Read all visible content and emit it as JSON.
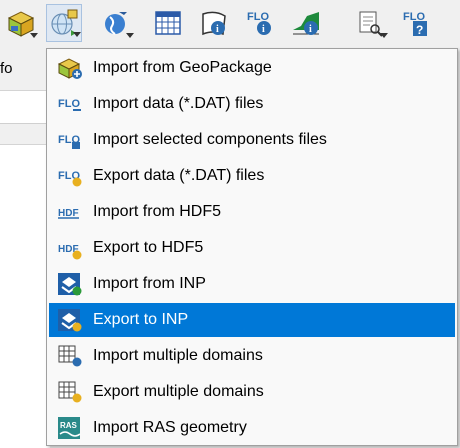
{
  "toolbar": {
    "buttons": [
      {
        "icon": "geopackage-3d-icon"
      },
      {
        "icon": "import-export-globe-icon",
        "active": true
      },
      {
        "icon": "globe-arrow-icon"
      },
      {
        "icon": "grid-table-icon"
      },
      {
        "icon": "map-info-icon"
      },
      {
        "icon": "flo-info-icon"
      },
      {
        "icon": "profile-info-icon"
      },
      {
        "icon": "report-search-icon"
      },
      {
        "icon": "flo-help-icon"
      }
    ]
  },
  "left_panel": {
    "tab_label": "fo"
  },
  "menu": {
    "items": [
      {
        "label": "Import from GeoPackage",
        "icon": "geopackage-import-icon"
      },
      {
        "label": "Import data (*.DAT) files",
        "icon": "flo-import-icon"
      },
      {
        "label": "Import selected components files",
        "icon": "flo-import-selected-icon"
      },
      {
        "label": "Export data (*.DAT) files",
        "icon": "flo-export-icon"
      },
      {
        "label": "Import from HDF5",
        "icon": "hdf5-import-icon"
      },
      {
        "label": "Export to HDF5",
        "icon": "hdf5-export-icon"
      },
      {
        "label": "Import from INP",
        "icon": "inp-import-icon"
      },
      {
        "label": "Export to INP",
        "icon": "inp-export-icon",
        "highlighted": true
      },
      {
        "label": "Import multiple domains",
        "icon": "multi-domain-import-icon"
      },
      {
        "label": "Export multiple domains",
        "icon": "multi-domain-export-icon"
      },
      {
        "label": "Import RAS geometry",
        "icon": "ras-import-icon"
      }
    ]
  },
  "colors": {
    "highlight": "#0078d7",
    "flo_blue": "#2b6cb0"
  }
}
